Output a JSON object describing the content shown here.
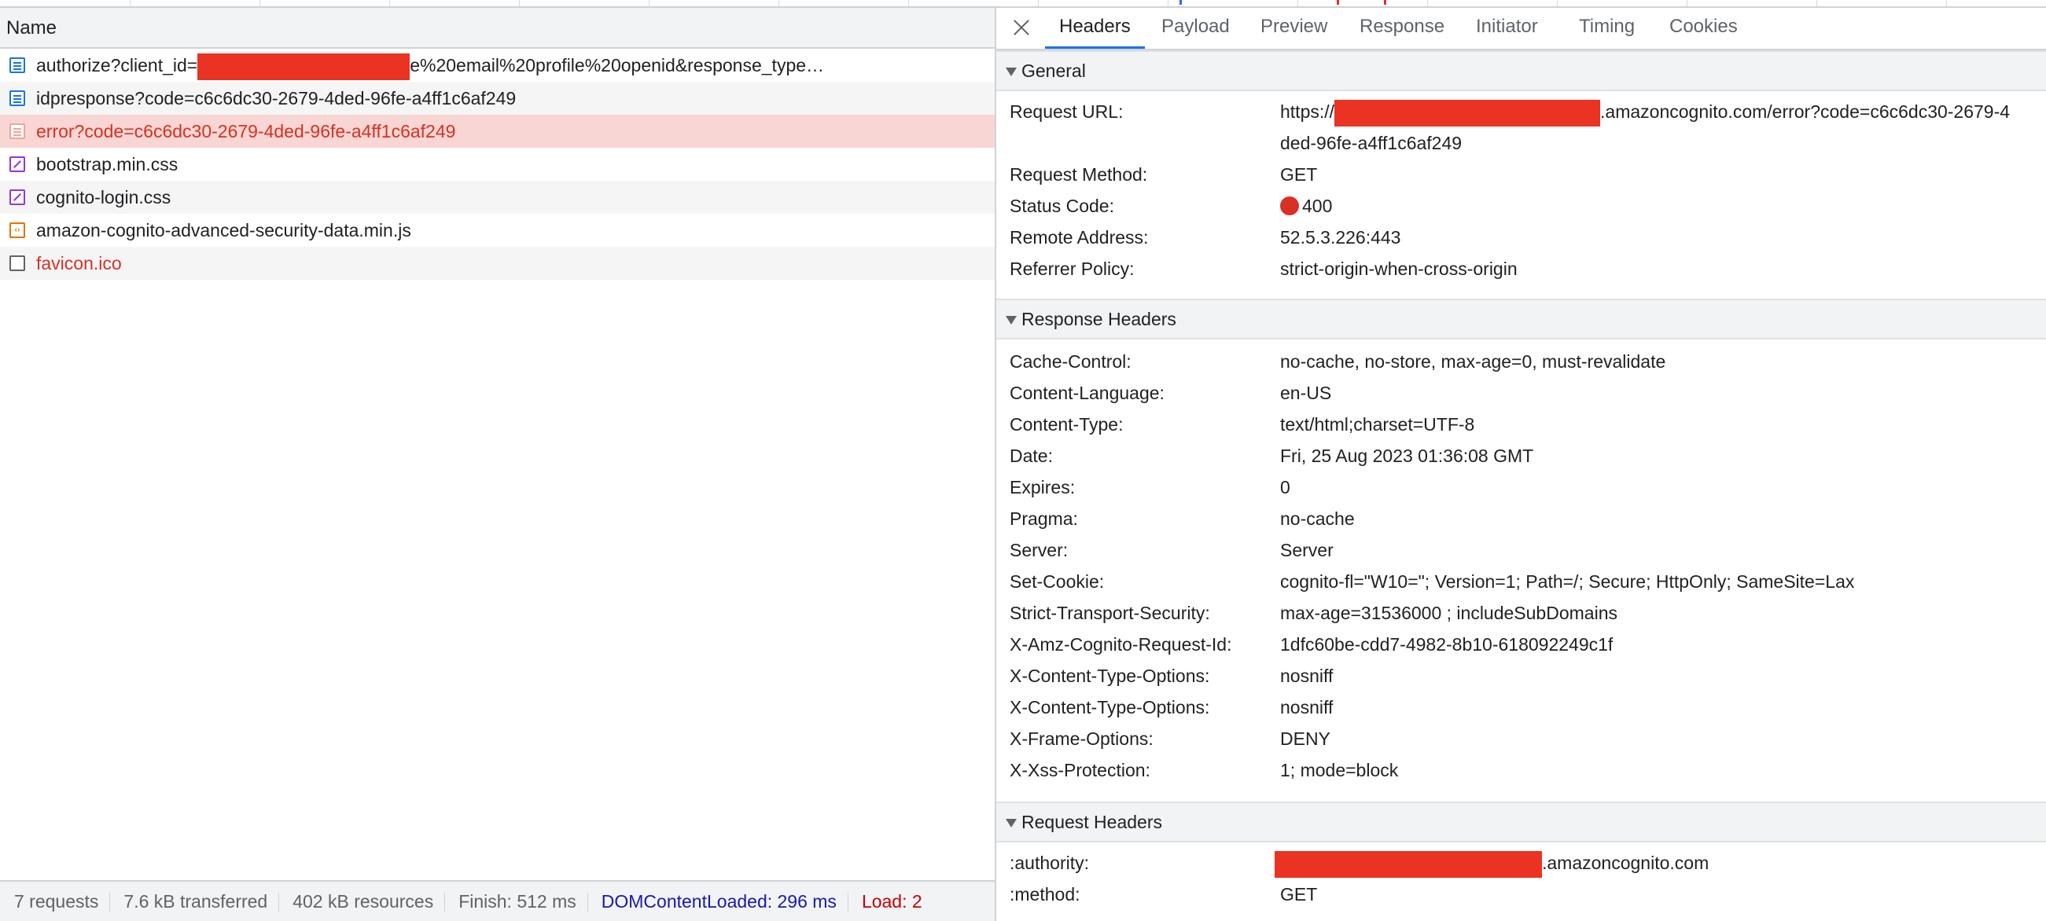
{
  "left": {
    "column_header": "Name",
    "requests": [
      {
        "icon": "document-icon",
        "prefix": "authorize?client_id=",
        "suffix": "e%20email%20profile%20openid&response_type…",
        "error": false
      },
      {
        "icon": "document-icon",
        "label": "idpresponse?code=c6c6dc30-2679-4ded-96fe-a4ff1c6af249",
        "error": false
      },
      {
        "icon": "document-icon",
        "label": "error?code=c6c6dc30-2679-4ded-96fe-a4ff1c6af249",
        "error": true,
        "selected": true
      },
      {
        "icon": "stylesheet-icon",
        "label": "bootstrap.min.css",
        "error": false
      },
      {
        "icon": "stylesheet-icon",
        "label": "cognito-login.css",
        "error": false
      },
      {
        "icon": "script-icon",
        "label": "amazon-cognito-advanced-security-data.min.js",
        "error": false
      },
      {
        "icon": "other-file-icon",
        "label": "favicon.ico",
        "error": true
      }
    ],
    "status_bar": {
      "requests": "7 requests",
      "transferred": "7.6 kB transferred",
      "resources": "402 kB resources",
      "finish": "Finish: 512 ms",
      "dom_content_loaded": "DOMContentLoaded: 296 ms",
      "load": "Load: 2"
    }
  },
  "right": {
    "tabs": [
      "Headers",
      "Payload",
      "Preview",
      "Response",
      "Initiator",
      "Timing",
      "Cookies"
    ],
    "active_tab": "Headers",
    "general": {
      "title": "General",
      "request_url_key": "Request URL:",
      "request_url_prefix": "https://",
      "request_url_suffix": ".amazoncognito.com/error?code=c6c6dc30-2679-4",
      "request_url_cont": "ded-96fe-a4ff1c6af249",
      "request_method_key": "Request Method:",
      "request_method": "GET",
      "status_code_key": "Status Code:",
      "status_code": "400",
      "remote_address_key": "Remote Address:",
      "remote_address": "52.5.3.226:443",
      "referrer_policy_key": "Referrer Policy:",
      "referrer_policy": "strict-origin-when-cross-origin"
    },
    "response_headers": {
      "title": "Response Headers",
      "rows": [
        {
          "k": "Cache-Control:",
          "v": "no-cache, no-store, max-age=0, must-revalidate"
        },
        {
          "k": "Content-Language:",
          "v": "en-US"
        },
        {
          "k": "Content-Type:",
          "v": "text/html;charset=UTF-8"
        },
        {
          "k": "Date:",
          "v": "Fri, 25 Aug 2023 01:36:08 GMT"
        },
        {
          "k": "Expires:",
          "v": "0"
        },
        {
          "k": "Pragma:",
          "v": "no-cache"
        },
        {
          "k": "Server:",
          "v": "Server"
        },
        {
          "k": "Set-Cookie:",
          "v": "cognito-fl=\"W10=\"; Version=1; Path=/; Secure; HttpOnly; SameSite=Lax"
        },
        {
          "k": "Strict-Transport-Security:",
          "v": "max-age=31536000 ; includeSubDomains"
        },
        {
          "k": "X-Amz-Cognito-Request-Id:",
          "v": "1dfc60be-cdd7-4982-8b10-618092249c1f"
        },
        {
          "k": "X-Content-Type-Options:",
          "v": "nosniff"
        },
        {
          "k": "X-Content-Type-Options:",
          "v": "nosniff"
        },
        {
          "k": "X-Frame-Options:",
          "v": "DENY"
        },
        {
          "k": "X-Xss-Protection:",
          "v": "1; mode=block"
        }
      ]
    },
    "request_headers": {
      "title": "Request Headers",
      "authority_key": ":authority:",
      "authority_suffix": ".amazoncognito.com",
      "method_key": ":method:",
      "method": "GET"
    }
  },
  "colors": {
    "error": "#d93025",
    "selected_row": "#f8d6d3",
    "redaction": "#ea3323",
    "accent": "#1a73e8"
  }
}
